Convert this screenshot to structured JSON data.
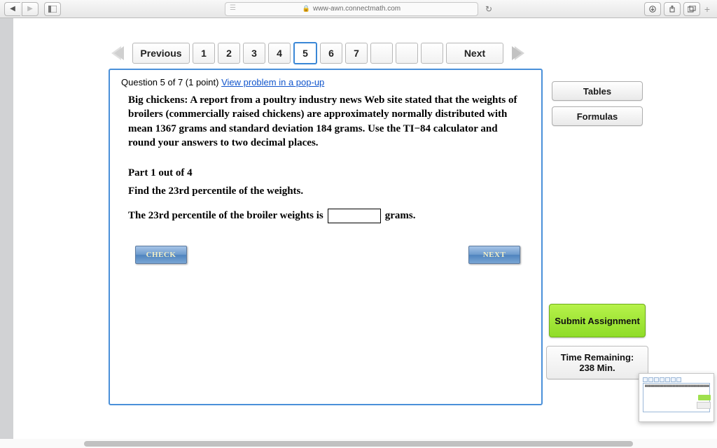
{
  "browser": {
    "url": "www-awn.connectmath.com"
  },
  "pager": {
    "prev_label": "Previous",
    "next_label": "Next",
    "numbers": [
      "1",
      "2",
      "3",
      "4",
      "5",
      "6",
      "7",
      "",
      "",
      ""
    ],
    "active_index": 4
  },
  "question": {
    "header_prefix": "Question 5 of 7 (1 point) ",
    "popup_link": "View problem in a pop-up",
    "intro_bold": "Big chickens:",
    "intro_rest": " A report from a poultry industry news Web site stated that the weights of broilers (commercially raised chickens) are approximately normally distributed with mean 1367 grams and standard deviation 184 grams. Use the TI−84 calculator and round your answers to two decimal places.",
    "part_label": "Part 1 out of 4",
    "part_prompt": "Find the 23rd percentile of the weights.",
    "answer_before": "The 23rd percentile of the broiler weights is",
    "answer_after": "grams.",
    "check_label": "CHECK",
    "next_label": "NEXT"
  },
  "sidebar": {
    "tables_label": "Tables",
    "formulas_label": "Formulas",
    "submit_label": "Submit Assignment",
    "timer_title": "Time Remaining:",
    "timer_value": "238 Min."
  }
}
